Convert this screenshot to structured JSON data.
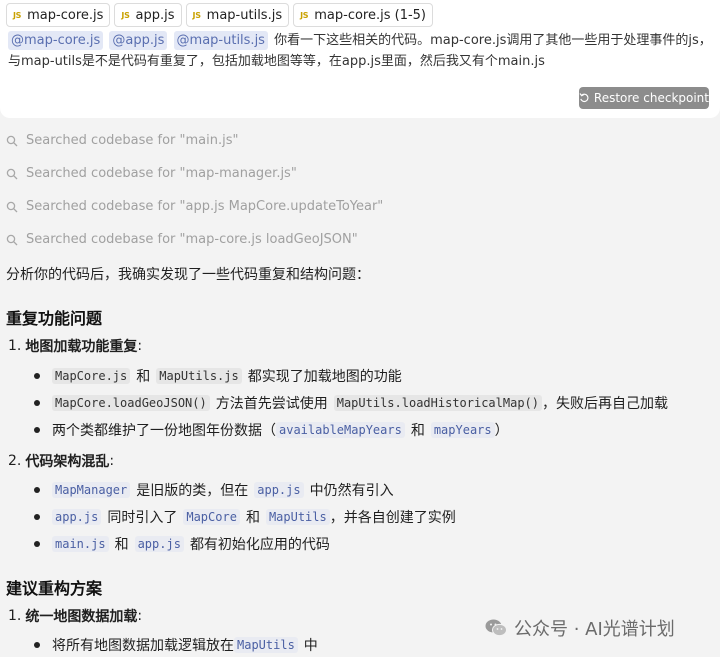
{
  "attached_files": [
    {
      "name": "map-core.js",
      "icon": "js-file-icon"
    },
    {
      "name": "app.js",
      "icon": "js-file-icon"
    },
    {
      "name": "map-utils.js",
      "icon": "js-file-icon"
    },
    {
      "name": "map-core.js (1-5)",
      "icon": "js-file-icon"
    }
  ],
  "js_icon_text": "JS",
  "user_message": {
    "mentions": [
      "@map-core.js",
      "@app.js",
      "@map-utils.js"
    ],
    "text": "你看一下这些相关的代码。map-core.js调用了其他一些用于处理事件的js，与map-utils是不是代码有重复了，包括加载地图等等，在app.js里面，然后我又有个main.js"
  },
  "restore_button": {
    "label": "Restore checkpoint",
    "icon": "restore-arrow-icon"
  },
  "search_steps": [
    "Searched codebase for \"main.js\"",
    "Searched codebase for \"map-manager.js\"",
    "Searched codebase for \"app.js MapCore.updateToYear\"",
    "Searched codebase for \"map-core.js loadGeoJSON\""
  ],
  "response": {
    "intro": "分析你的代码后，我确实发现了一些代码重复和结构问题：",
    "section1_title": "重复功能问题",
    "item1": {
      "num": "1.",
      "title": "地图加载功能重复",
      "colon": ":"
    },
    "item1_bullets": {
      "b1": {
        "c1": "MapCore.js",
        "t1": "和",
        "c2": "MapUtils.js",
        "t2": "都实现了加载地图的功能"
      },
      "b2": {
        "c1": "MapCore.loadGeoJSON()",
        "t1": "方法首先尝试使用",
        "c2": "MapUtils.loadHistoricalMap()",
        "t2": "，失败后再自己加载"
      },
      "b3": {
        "t1": "两个类都维护了一份地图年份数据（",
        "c1": "availableMapYears",
        "t2": "和",
        "c2": "mapYears",
        "t3": "）"
      }
    },
    "item2": {
      "num": "2.",
      "title": "代码架构混乱",
      "colon": ":"
    },
    "item2_bullets": {
      "b1": {
        "c1": "MapManager",
        "t1": "是旧版的类，但在",
        "c2": "app.js",
        "t2": "中仍然有引入"
      },
      "b2": {
        "c1": "app.js",
        "t1": "同时引入了",
        "c2": "MapCore",
        "t2": "和",
        "c3": "MapUtils",
        "t3": "，并各自创建了实例"
      },
      "b3": {
        "c1": "main.js",
        "t1": "和",
        "c2": "app.js",
        "t2": "都有初始化应用的代码"
      }
    },
    "section2_title": "建议重构方案",
    "item3": {
      "num": "1.",
      "title": "统一地图数据加载",
      "colon": ":"
    },
    "item3_bullets": {
      "b1": {
        "t1": "将所有地图数据加载逻辑放在",
        "c1": "MapUtils",
        "t2": "中"
      }
    }
  },
  "watermark": {
    "text": "公众号 · AI光谱计划",
    "icon": "wechat-icon"
  }
}
